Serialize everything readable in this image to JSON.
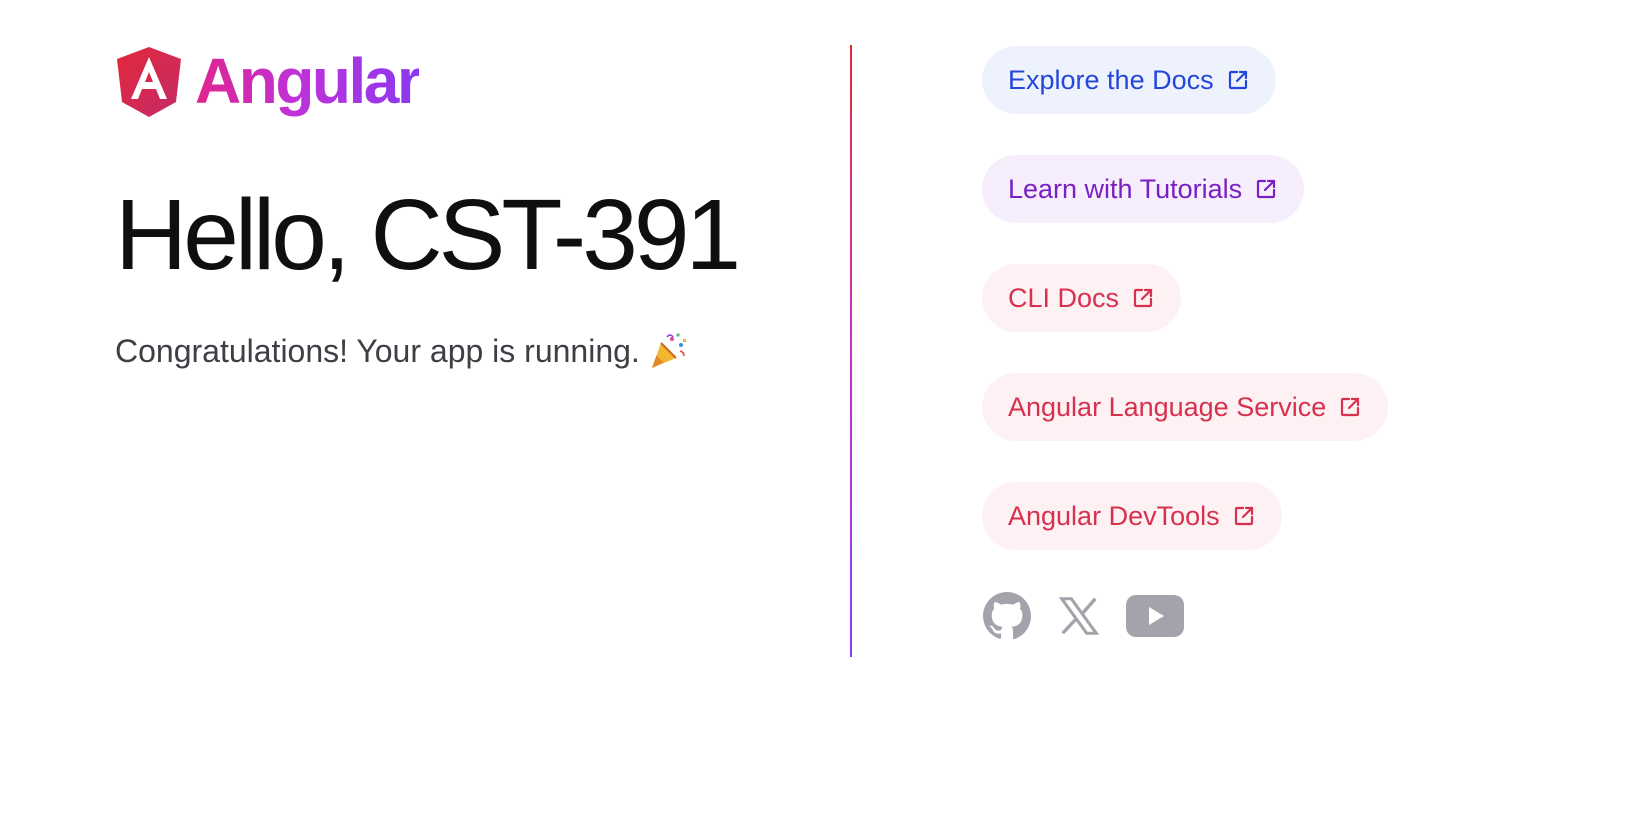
{
  "logo": {
    "wordmark": "Angular"
  },
  "main": {
    "greeting": "Hello, CST-391",
    "subtitle": "Congratulations! Your app is running.",
    "subtitle_emoji": "party-popper-icon"
  },
  "colors": {
    "divider_gradient": [
      "#e12d3a",
      "#c532c9",
      "#8a3bef"
    ],
    "social_icon": "#a3a3ac",
    "blue_pill_text": "#2347d8",
    "purple_pill_text": "#7a1fc2",
    "red_pill_text": "#d8304f"
  },
  "links": [
    {
      "label": "Explore the Docs",
      "style": "blue"
    },
    {
      "label": "Learn with Tutorials",
      "style": "purple"
    },
    {
      "label": "CLI Docs",
      "style": "red"
    },
    {
      "label": "Angular Language Service",
      "style": "red"
    },
    {
      "label": "Angular DevTools",
      "style": "red"
    }
  ],
  "socials": [
    {
      "name": "github-icon"
    },
    {
      "name": "x-twitter-icon"
    },
    {
      "name": "youtube-icon"
    }
  ]
}
